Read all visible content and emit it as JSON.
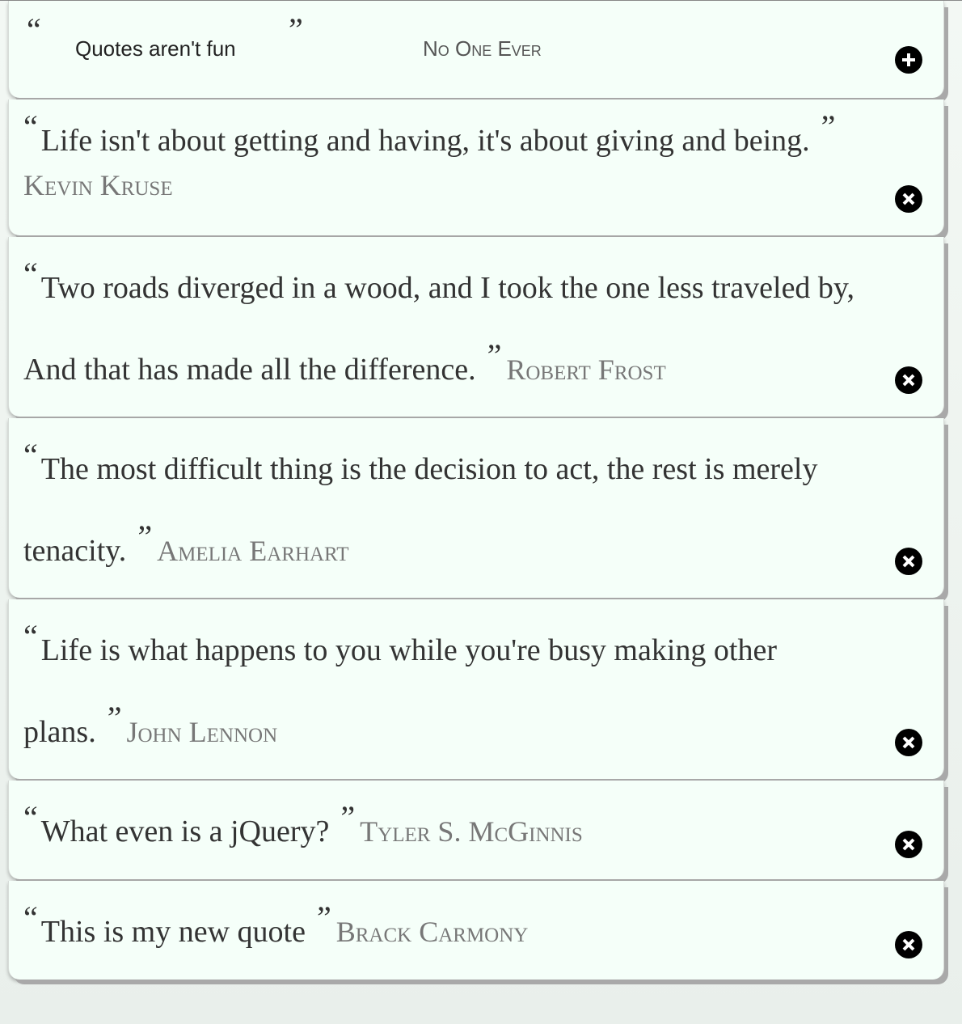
{
  "new_quote_form": {
    "open_mark": "“",
    "close_mark": "”",
    "quote_placeholder": "Quotes aren't fun",
    "author_placeholder": "No One Ever",
    "add_icon": "plus-circle-icon"
  },
  "quotes": [
    {
      "text": "Life isn't about getting and having, it's about giving and being.",
      "author": "Kevin Kruse"
    },
    {
      "text": "Two roads diverged in a wood, and I took the one less traveled by, And that has made all the difference.",
      "author": "Robert Frost"
    },
    {
      "text": "The most difficult thing is the decision to act, the rest is merely tenacity.",
      "author": "Amelia Earhart"
    },
    {
      "text": "Life is what happens to you while you're busy making other plans.",
      "author": "John Lennon"
    },
    {
      "text": "What even is a jQuery?",
      "author": "Tyler S. McGinnis"
    },
    {
      "text": "This is my new quote",
      "author": "Brack Carmony"
    }
  ],
  "marks": {
    "open": "“",
    "close": "”"
  },
  "remove_icon": "x-circle-icon"
}
